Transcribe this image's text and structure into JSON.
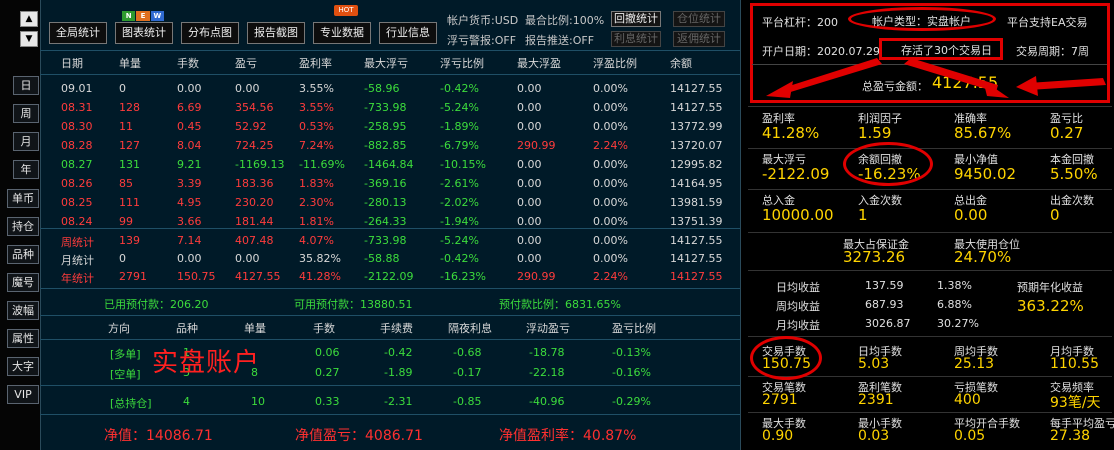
{
  "left": {
    "up_icon": "▲",
    "down_icon": "▼",
    "period": [
      "日",
      "周",
      "月",
      "年"
    ],
    "menu": [
      "单币",
      "持仓",
      "品种",
      "魔号",
      "波幅",
      "属性",
      "大字",
      "VIP"
    ]
  },
  "toolbar": {
    "global_stats": "全局统计",
    "chart_stats": "图表统计",
    "distribution": "分布点图",
    "report_screenshot": "报告截图",
    "pro_data": "专业数据",
    "industry_info": "行业信息",
    "new_badge": "NEW",
    "hot_badge": "HOT"
  },
  "meta": {
    "currency": "帐户货币:USD",
    "max_ratio": "最合比例:100%",
    "float_alert": "浮亏警报:OFF",
    "report_push": "报告推送:OFF",
    "buttons": [
      "回撤统计",
      "仓位统计",
      "利息统计",
      "返佣统计"
    ]
  },
  "table": {
    "headers": [
      "日期",
      "单量",
      "手数",
      "盈亏",
      "盈利率",
      "最大浮亏",
      "浮亏比例",
      "最大浮盈",
      "浮盈比例",
      "余额"
    ],
    "rows": [
      [
        "09.01",
        "0",
        "0.00",
        "0.00",
        "3.55%",
        "-58.96",
        "-0.42%",
        "0.00",
        "0.00%",
        "14127.55"
      ],
      [
        "08.31",
        "128",
        "6.69",
        "354.56",
        "3.55%",
        "-733.98",
        "-5.24%",
        "0.00",
        "0.00%",
        "14127.55"
      ],
      [
        "08.30",
        "11",
        "0.45",
        "52.92",
        "0.53%",
        "-258.95",
        "-1.89%",
        "0.00",
        "0.00%",
        "13772.99"
      ],
      [
        "08.28",
        "127",
        "8.04",
        "724.25",
        "7.24%",
        "-882.85",
        "-6.79%",
        "290.99",
        "2.24%",
        "13720.07"
      ],
      [
        "08.27",
        "131",
        "9.21",
        "-1169.13",
        "-11.69%",
        "-1464.84",
        "-10.15%",
        "0.00",
        "0.00%",
        "12995.82"
      ],
      [
        "08.26",
        "85",
        "3.39",
        "183.36",
        "1.83%",
        "-369.16",
        "-2.61%",
        "0.00",
        "0.00%",
        "14164.95"
      ],
      [
        "08.25",
        "111",
        "4.95",
        "230.20",
        "2.30%",
        "-280.13",
        "-2.02%",
        "0.00",
        "0.00%",
        "13981.59"
      ],
      [
        "08.24",
        "99",
        "3.66",
        "181.44",
        "1.81%",
        "-264.33",
        "-1.94%",
        "0.00",
        "0.00%",
        "13751.39"
      ]
    ],
    "stats": [
      [
        "周统计",
        "139",
        "7.14",
        "407.48",
        "4.07%",
        "-733.98",
        "-5.24%",
        "0.00",
        "0.00%",
        "14127.55"
      ],
      [
        "月统计",
        "0",
        "0.00",
        "0.00",
        "35.82%",
        "-58.88",
        "-0.42%",
        "0.00",
        "0.00%",
        "14127.55"
      ],
      [
        "年统计",
        "2791",
        "150.75",
        "4127.55",
        "41.28%",
        "-2122.09",
        "-16.23%",
        "290.99",
        "2.24%",
        "14127.55"
      ]
    ]
  },
  "margin": {
    "used": "已用预付款：206.20",
    "available": "可用预付款：13880.51",
    "ratio": "预付款比例：6831.65%"
  },
  "positions": {
    "headers": [
      "方向",
      "品种",
      "单量",
      "手数",
      "手续费",
      "隔夜利息",
      "浮动盈亏",
      "盈亏比例"
    ],
    "rows": [
      [
        "[多单]",
        "1",
        "",
        "0.06",
        "-0.42",
        "-0.68",
        "-18.78",
        "-0.13%"
      ],
      [
        "[空单]",
        "3",
        "8",
        "0.27",
        "-1.89",
        "-0.17",
        "-22.18",
        "-0.16%"
      ],
      [
        "[总持仓]",
        "4",
        "10",
        "0.33",
        "-2.31",
        "-0.85",
        "-40.96",
        "-0.29%"
      ]
    ],
    "overlay": "实盘账户"
  },
  "footer": {
    "net": "净值：14086.71",
    "net_pnl": "净值盈亏：4086.71",
    "net_rate": "净值盈利率：40.87%"
  },
  "account": {
    "leverage": "平台杠杆：200",
    "type": "帐户类型：实盘帐户",
    "ea": "平台支持EA交易",
    "open_date": "开户日期：2020.07.29",
    "survived": "存活了30个交易日",
    "cycle": "交易周期：7周",
    "total_label": "总盈亏金额：",
    "total_value": "4127.55"
  },
  "metrics": [
    {
      "l": "盈利率",
      "v": "41.28%"
    },
    {
      "l": "利润因子",
      "v": "1.59"
    },
    {
      "l": "准确率",
      "v": "85.67%"
    },
    {
      "l": "盈亏比",
      "v": "0.27"
    },
    {
      "l": "最大浮亏",
      "v": "-2122.09"
    },
    {
      "l": "余额回撤",
      "v": "-16.23%"
    },
    {
      "l": "最小净值",
      "v": "9450.02"
    },
    {
      "l": "本金回撤",
      "v": "5.50%"
    },
    {
      "l": "总入金",
      "v": "10000.00"
    },
    {
      "l": "入金次数",
      "v": "1"
    },
    {
      "l": "总出金",
      "v": "0.00"
    },
    {
      "l": "出金次数",
      "v": "0"
    }
  ],
  "margin_stats": {
    "max_margin_label": "最大占保证金",
    "max_margin": "3273.26",
    "max_pos_label": "最大使用仓位",
    "max_pos": "24.70%"
  },
  "income": {
    "rows": [
      [
        "日均收益",
        "137.59",
        "1.38%"
      ],
      [
        "周均收益",
        "687.93",
        "6.88%"
      ],
      [
        "月均收益",
        "3026.87",
        "30.27%"
      ]
    ],
    "annual_label": "预期年化收益",
    "annual": "363.22%"
  },
  "metrics2": [
    {
      "l": "交易手数",
      "v": "150.75"
    },
    {
      "l": "日均手数",
      "v": "5.03"
    },
    {
      "l": "周均手数",
      "v": "25.13"
    },
    {
      "l": "月均手数",
      "v": "110.55"
    },
    {
      "l": "交易笔数",
      "v": "2791"
    },
    {
      "l": "盈利笔数",
      "v": "2391"
    },
    {
      "l": "亏损笔数",
      "v": "400"
    },
    {
      "l": "交易频率",
      "v": "93笔/天"
    },
    {
      "l": "最大手数",
      "v": "0.90"
    },
    {
      "l": "最小手数",
      "v": "0.03"
    },
    {
      "l": "平均开合手数",
      "v": "0.05"
    },
    {
      "l": "每手平均盈亏",
      "v": "27.38"
    }
  ],
  "colors": {
    "annotation": "#e00000",
    "value": "#ffd400",
    "profit": "#ff3c3c",
    "loss": "#3cdc3c"
  }
}
